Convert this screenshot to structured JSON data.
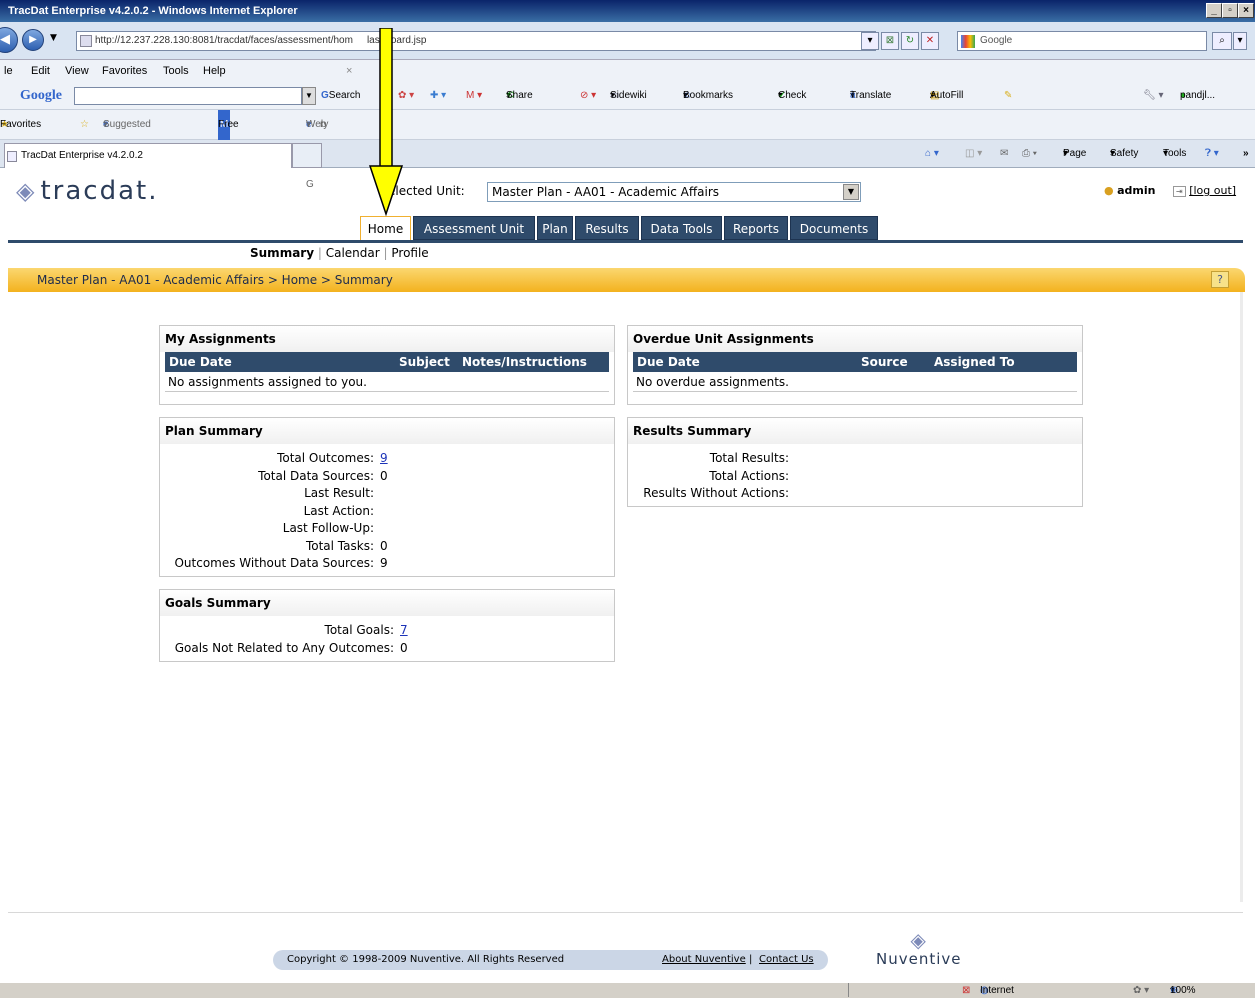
{
  "browser": {
    "window_title": "TracDat Enterprise v4.2.0.2 - Windows Internet Explorer",
    "url_host": "http://12.237.228.130",
    "url_path": ":8081/tracdat/faces/assessment/home/dashboard.jsp",
    "url_visible": "http://12.237.228.130:8081/tracdat/faces/assessment/hom",
    "url_visible_tail": "lashboard.jsp",
    "search_placeholder": "Google",
    "menu": [
      "le",
      "Edit",
      "View",
      "Favorites",
      "Tools",
      "Help"
    ],
    "google_toolbar": {
      "logo": "Google",
      "search": "Search",
      "share": "Share",
      "sidewiki": "Sidewiki",
      "bookmarks": "Bookmarks",
      "check": "Check",
      "translate": "Translate",
      "autofill": "AutoFill",
      "user": "pandjl..."
    },
    "favorites": {
      "label": "Favorites",
      "suggested": "Suggested Sites",
      "hotmail": "Free Hotmail",
      "webslice": "Web Slice G",
      "webslice_tail": "ry"
    },
    "tab_title": "TracDat Enterprise v4.2.0.2",
    "command_bar": {
      "page": "Page",
      "safety": "Safety",
      "tools": "Tools"
    },
    "status": {
      "zone": "Internet",
      "zoom": "100%"
    }
  },
  "app": {
    "logo_text": "tracdat.",
    "selected_unit_label": "elected Unit:",
    "selected_unit_value": "Master Plan - AA01 - Academic Affairs",
    "user": "admin",
    "logout": "[log out]",
    "tabs": [
      "Home",
      "Assessment Unit",
      "Plan",
      "Results",
      "Data Tools",
      "Reports",
      "Documents"
    ],
    "subnav": {
      "summary": "Summary",
      "calendar": "Calendar",
      "profile": "Profile"
    },
    "breadcrumb": "Master Plan - AA01 - Academic Affairs > Home > Summary"
  },
  "my_assignments": {
    "title": "My Assignments",
    "columns": [
      "Due Date",
      "Subject",
      "Notes/Instructions"
    ],
    "empty": "No assignments assigned to you."
  },
  "overdue": {
    "title": "Overdue Unit Assignments",
    "columns": [
      "Due Date",
      "Source",
      "Assigned To"
    ],
    "empty": "No overdue assignments."
  },
  "plan_summary": {
    "title": "Plan Summary",
    "rows": [
      {
        "label": "Total Outcomes:",
        "value": "9"
      },
      {
        "label": "Total Data Sources:",
        "value": "0"
      },
      {
        "label": "Last Result:",
        "value": ""
      },
      {
        "label": "Last Action:",
        "value": ""
      },
      {
        "label": "Last Follow-Up:",
        "value": ""
      },
      {
        "label": "Total Tasks:",
        "value": "0"
      },
      {
        "label": "Outcomes Without Data Sources:",
        "value": "9"
      }
    ]
  },
  "results_summary": {
    "title": "Results Summary",
    "rows": [
      {
        "label": "Total Results:",
        "value": ""
      },
      {
        "label": "Total Actions:",
        "value": ""
      },
      {
        "label": "Results Without Actions:",
        "value": ""
      }
    ]
  },
  "goals_summary": {
    "title": "Goals Summary",
    "rows": [
      {
        "label": "Total Goals:",
        "value": "7"
      },
      {
        "label": "Goals Not Related to Any Outcomes:",
        "value": "0"
      }
    ]
  },
  "footer": {
    "copyright": "Copyright © 1998-2009 Nuventive. All Rights Reserved",
    "about": "About Nuventive",
    "contact": "Contact Us",
    "brand": "Nuventive"
  },
  "colors": {
    "nav_dark": "#2f4b6b",
    "accent_orange": "#f3b21e",
    "annotation_arrow": "#ffff00"
  }
}
